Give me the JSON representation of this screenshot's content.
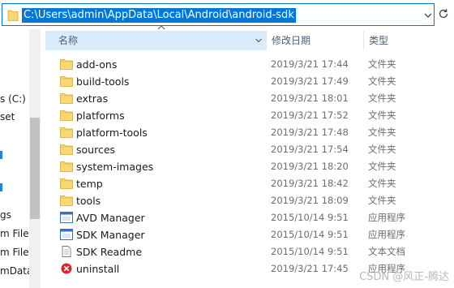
{
  "address_bar": {
    "path": "C:\\Users\\admin\\AppData\\Local\\Android\\android-sdk"
  },
  "nav_pane": {
    "items": [
      {
        "label": "s (C:)"
      },
      {
        "label": "set"
      },
      {
        "label": "gs"
      },
      {
        "label": "m Files"
      },
      {
        "label": "m Files"
      },
      {
        "label": "mData"
      }
    ]
  },
  "columns": {
    "name": "名称",
    "date": "修改日期",
    "type": "类型"
  },
  "files": [
    {
      "name": "add-ons",
      "date": "2019/3/21 17:44",
      "type": "文件夹",
      "icon": "folder-icon"
    },
    {
      "name": "build-tools",
      "date": "2019/3/21 17:49",
      "type": "文件夹",
      "icon": "folder-icon"
    },
    {
      "name": "extras",
      "date": "2019/3/21 18:01",
      "type": "文件夹",
      "icon": "folder-icon"
    },
    {
      "name": "platforms",
      "date": "2019/3/21 17:52",
      "type": "文件夹",
      "icon": "folder-icon"
    },
    {
      "name": "platform-tools",
      "date": "2019/3/21 17:48",
      "type": "文件夹",
      "icon": "folder-icon"
    },
    {
      "name": "sources",
      "date": "2019/3/21 17:54",
      "type": "文件夹",
      "icon": "folder-icon"
    },
    {
      "name": "system-images",
      "date": "2019/3/21 18:20",
      "type": "文件夹",
      "icon": "folder-icon"
    },
    {
      "name": "temp",
      "date": "2019/3/21 18:42",
      "type": "文件夹",
      "icon": "folder-icon"
    },
    {
      "name": "tools",
      "date": "2019/3/21 18:09",
      "type": "文件夹",
      "icon": "folder-icon"
    },
    {
      "name": "AVD Manager",
      "date": "2015/10/14 9:51",
      "type": "应用程序",
      "icon": "application-icon"
    },
    {
      "name": "SDK Manager",
      "date": "2015/10/14 9:51",
      "type": "应用程序",
      "icon": "application-icon"
    },
    {
      "name": "SDK Readme",
      "date": "2015/10/14 9:51",
      "type": "文本文档",
      "icon": "text-document-icon"
    },
    {
      "name": "uninstall",
      "date": "2019/3/21 17:45",
      "type": "应用程序",
      "icon": "uninstall-icon"
    }
  ],
  "watermark": "CSDN @风正-腾达",
  "colors": {
    "selection": "#0078d7",
    "header_hover": "#d9ebf9",
    "folder": "#f8d775",
    "uninstall": "#d9262b"
  }
}
